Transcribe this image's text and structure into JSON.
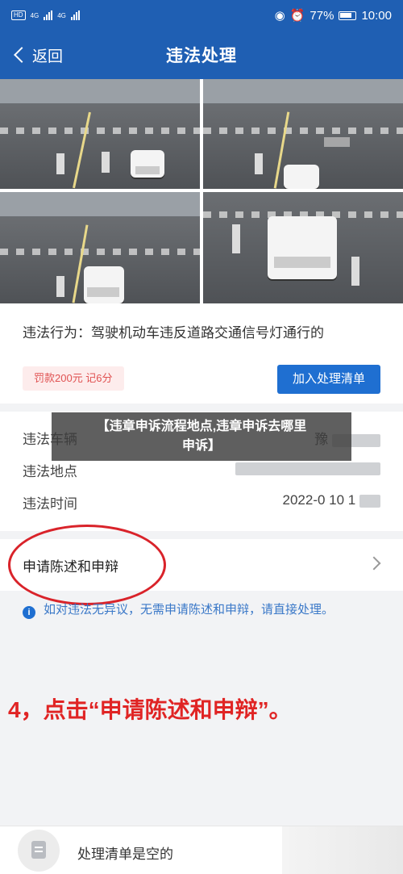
{
  "status_bar": {
    "sim1": "HD",
    "sim2": "HD",
    "net1": "4G",
    "net2": "4G",
    "battery": "77%",
    "time": "10:00"
  },
  "nav": {
    "back_label": "返回",
    "title": "违法处理"
  },
  "violation": {
    "behavior": "违法行为：驾驶机动车违反道路交通信号灯通行的",
    "fine": "罚款200元 记6分",
    "add_button": "加入处理清单"
  },
  "details": {
    "rows": [
      {
        "label": "违法车辆",
        "value": "豫"
      },
      {
        "label": "违法地点",
        "value": ""
      },
      {
        "label": "违法时间",
        "value": "2022-0 10 1"
      }
    ]
  },
  "overlay": {
    "line1": "【违章申诉流程地点,违章申诉去哪里",
    "line2": "申诉】"
  },
  "appeal": {
    "label": "申请陈述和申辩"
  },
  "notice": {
    "text": "如对违法无异议，无需申请陈述和申辩，请直接处理。"
  },
  "instruction": {
    "text": "4，点击“申请陈述和申辩”。"
  },
  "bottom": {
    "empty_text": "处理清单是空的"
  }
}
